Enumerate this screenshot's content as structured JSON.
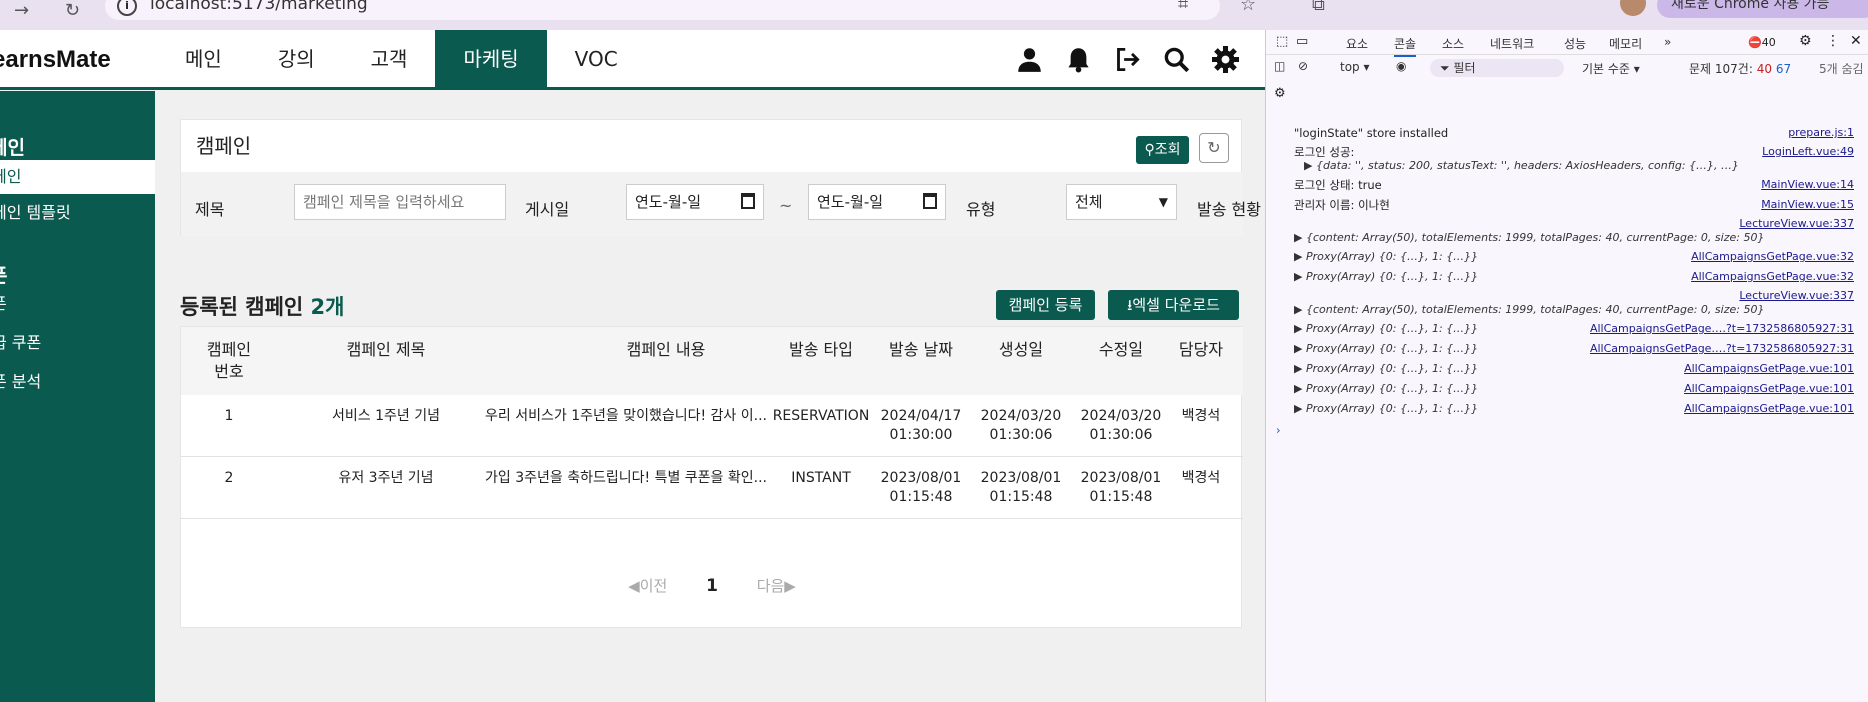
{
  "browser": {
    "url": "localhost:5173/marketing",
    "profile_label": "새로운 Chrome 사용 가능"
  },
  "app": {
    "brand": "earnsMate",
    "menu": [
      "메인",
      "강의",
      "고객",
      "마케팅",
      "VOC"
    ],
    "active_menu": "마케팅",
    "sidebar": {
      "section1": "페인",
      "section1_items": [
        "페인",
        "페인 템플릿"
      ],
      "section2": "폰",
      "section2_items": [
        "폰",
        "급 쿠폰",
        "폰 분석"
      ]
    },
    "search": {
      "title": "캠페인",
      "search_button": "조회",
      "title_label": "제목",
      "title_placeholder": "캠페인 제목을 입력하세요",
      "date_label": "게시일",
      "date_from": "연도-월-일",
      "date_sep": "~",
      "date_to": "연도-월-일",
      "type_label": "유형",
      "type_value": "전체",
      "status_label": "발송 현황"
    },
    "list": {
      "title_prefix": "등록된 캠페인",
      "count": "2개",
      "register_button": "캠페인 등록",
      "excel_button": "엑셀 다운로드",
      "headers": [
        "캠페인 번호",
        "캠페인 제목",
        "캠페인 내용",
        "발송 타입",
        "발송 날짜",
        "생성일",
        "수정일",
        "담당자"
      ],
      "rows": [
        {
          "no": "1",
          "title": "서비스 1주년 기념",
          "content": "우리 서비스가 1주년을 맞이했습니다! 감사 이...",
          "type": "RESERVATION",
          "send_date": "2024/04/17",
          "send_time": "01:30:00",
          "created_date": "2024/03/20",
          "created_time": "01:30:06",
          "updated_date": "2024/03/20",
          "updated_time": "01:30:06",
          "manager": "백경석"
        },
        {
          "no": "2",
          "title": "유저 3주년 기념",
          "content": "가입 3주년을 축하드립니다! 특별 쿠폰을 확인...",
          "type": "INSTANT",
          "send_date": "2023/08/01",
          "send_time": "01:15:48",
          "created_date": "2023/08/01",
          "created_time": "01:15:48",
          "updated_date": "2023/08/01",
          "updated_time": "01:15:48",
          "manager": "백경석"
        }
      ],
      "pager": {
        "prev": "◀이전",
        "current": "1",
        "next": "다음▶"
      }
    }
  },
  "devtools": {
    "tabs": [
      "요소",
      "콘솔",
      "소스",
      "네트워크",
      "성능",
      "메모리",
      "»"
    ],
    "active_tab": "콘솔",
    "error_count": "40",
    "context": "top ▾",
    "filter_placeholder": "필터",
    "level": "기본 수준 ▾",
    "issues": "문제 107건:",
    "issues_err": "40",
    "issues_warn": "67",
    "hidden": "5개 숨김",
    "logs": [
      {
        "msg": "\"loginState\" store installed",
        "src": "prepare.js:1"
      },
      {
        "msg": "로그인 성공:",
        "src": "LoginLeft.vue:49"
      },
      {
        "msg": "▶ {data: '', status: 200, statusText: '', headers: AxiosHeaders, config: {…}, …}",
        "src": ""
      },
      {
        "msg": "로그인 상태: true",
        "src": "MainView.vue:14"
      },
      {
        "msg": "관리자 이름: 이나현",
        "src": "MainView.vue:15"
      },
      {
        "msg": "",
        "src": "LectureView.vue:337"
      },
      {
        "msg": "▶ {content: Array(50), totalElements: 1999, totalPages: 40, currentPage: 0, size: 50}",
        "src": ""
      },
      {
        "msg": "▶ Proxy(Array) {0: {…}, 1: {…}}",
        "src": "AllCampaignsGetPage.vue:32"
      },
      {
        "msg": "▶ Proxy(Array) {0: {…}, 1: {…}}",
        "src": "AllCampaignsGetPage.vue:32"
      },
      {
        "msg": "",
        "src": "LectureView.vue:337"
      },
      {
        "msg": "▶ {content: Array(50), totalElements: 1999, totalPages: 40, currentPage: 0, size: 50}",
        "src": ""
      },
      {
        "msg": "▶ Proxy(Array) {0: {…}, 1: {…}}",
        "src": "AllCampaignsGetPage.…?t=1732586805927:31"
      },
      {
        "msg": "▶ Proxy(Array) {0: {…}, 1: {…}}",
        "src": "AllCampaignsGetPage.…?t=1732586805927:31"
      },
      {
        "msg": "▶ Proxy(Array) {0: {…}, 1: {…}}",
        "src": "AllCampaignsGetPage.vue:101"
      },
      {
        "msg": "▶ Proxy(Array) {0: {…}, 1: {…}}",
        "src": "AllCampaignsGetPage.vue:101"
      },
      {
        "msg": "▶ Proxy(Array) {0: {…}, 1: {…}}",
        "src": "AllCampaignsGetPage.vue:101"
      }
    ],
    "prompt": "›"
  }
}
